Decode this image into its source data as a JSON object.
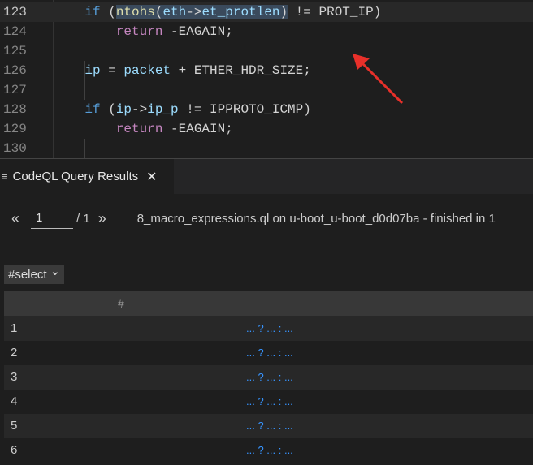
{
  "editor": {
    "lines": [
      {
        "n": "123",
        "tokens": [
          [
            "kw2",
            "if"
          ],
          [
            "pl",
            " ("
          ],
          [
            "sel fn",
            "ntohs"
          ],
          [
            "sel pl",
            "("
          ],
          [
            "sel id",
            "eth"
          ],
          [
            "sel pl",
            "->"
          ],
          [
            "sel id",
            "et_protlen"
          ],
          [
            "sel pl",
            ")"
          ],
          [
            "pl",
            " != PROT_IP)"
          ]
        ],
        "indent": "    "
      },
      {
        "n": "124",
        "tokens": [
          [
            "kw",
            "return"
          ],
          [
            "pl",
            " -EAGAIN;"
          ]
        ],
        "indent": "        "
      },
      {
        "n": "125",
        "tokens": [],
        "indent": ""
      },
      {
        "n": "126",
        "tokens": [
          [
            "id",
            "ip"
          ],
          [
            "pl",
            " = "
          ],
          [
            "id",
            "packet"
          ],
          [
            "pl",
            " + ETHER_HDR_SIZE;"
          ]
        ],
        "indent": "    "
      },
      {
        "n": "127",
        "tokens": [],
        "indent": ""
      },
      {
        "n": "128",
        "tokens": [
          [
            "kw2",
            "if"
          ],
          [
            "pl",
            " ("
          ],
          [
            "id",
            "ip"
          ],
          [
            "pl",
            "->"
          ],
          [
            "id",
            "ip_p"
          ],
          [
            "pl",
            " != IPPROTO_ICMP)"
          ]
        ],
        "indent": "    "
      },
      {
        "n": "129",
        "tokens": [
          [
            "kw",
            "return"
          ],
          [
            "pl",
            " -EAGAIN;"
          ]
        ],
        "indent": "        "
      },
      {
        "n": "130",
        "tokens": [],
        "indent": ""
      }
    ]
  },
  "panel": {
    "tab_title": "CodeQL Query Results",
    "close": "✕",
    "menu_icon": "≡"
  },
  "pager": {
    "prev": "«",
    "page": "1",
    "of": "/ 1",
    "next": "»",
    "query_info": "8_macro_expressions.ql on u-boot_u-boot_d0d07ba - finished in 1"
  },
  "select": {
    "value": "#select",
    "chevron": "⌄"
  },
  "table": {
    "header": "#",
    "rows": [
      {
        "n": "1",
        "v": "... ? ... : ..."
      },
      {
        "n": "2",
        "v": "... ? ... : ..."
      },
      {
        "n": "3",
        "v": "... ? ... : ..."
      },
      {
        "n": "4",
        "v": "... ? ... : ..."
      },
      {
        "n": "5",
        "v": "... ? ... : ..."
      },
      {
        "n": "6",
        "v": "... ? ... : ..."
      }
    ]
  },
  "annotation": {
    "color": "#e8302a"
  }
}
